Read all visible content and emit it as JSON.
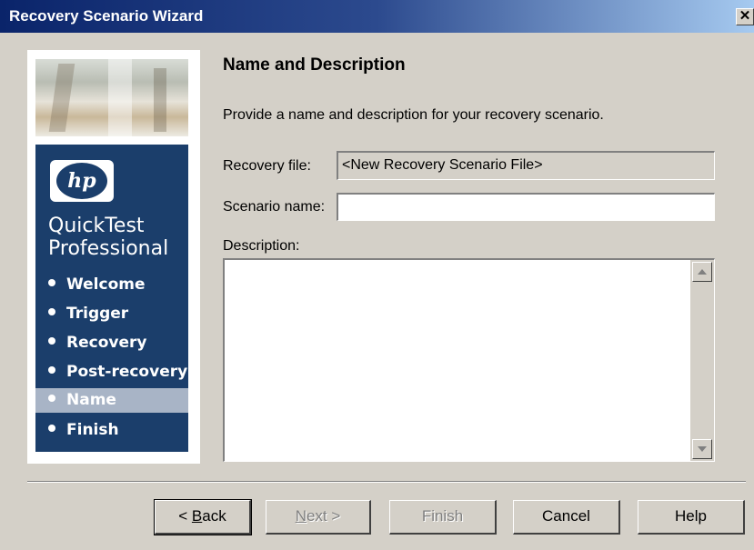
{
  "window": {
    "title": "Recovery Scenario Wizard",
    "close_glyph": "✕"
  },
  "sidebar": {
    "logo_text": "hp",
    "product_line1": "QuickTest",
    "product_line2": "Professional",
    "steps": [
      {
        "label": "Welcome",
        "active": false
      },
      {
        "label": "Trigger",
        "active": false
      },
      {
        "label": "Recovery",
        "active": false
      },
      {
        "label": "Post-recovery",
        "active": false
      },
      {
        "label": "Name",
        "active": true
      },
      {
        "label": "Finish",
        "active": false
      }
    ]
  },
  "main": {
    "heading": "Name and Description",
    "intro": "Provide a name and description for your recovery scenario.",
    "recovery_file_label": "Recovery file:",
    "recovery_file_value": "<New Recovery Scenario File>",
    "scenario_name_label": "Scenario name:",
    "scenario_name_value": "",
    "description_label": "Description:",
    "description_value": ""
  },
  "buttons": {
    "back_prefix": "< ",
    "back_underlined": "B",
    "back_rest": "ack",
    "next_underlined": "N",
    "next_rest": "ext >",
    "finish": "Finish",
    "cancel": "Cancel",
    "help": "Help"
  },
  "colors": {
    "sidebar_navy": "#1b3e6b",
    "active_step": "#a8b4c6",
    "dialog_bg": "#d4d0c8"
  }
}
